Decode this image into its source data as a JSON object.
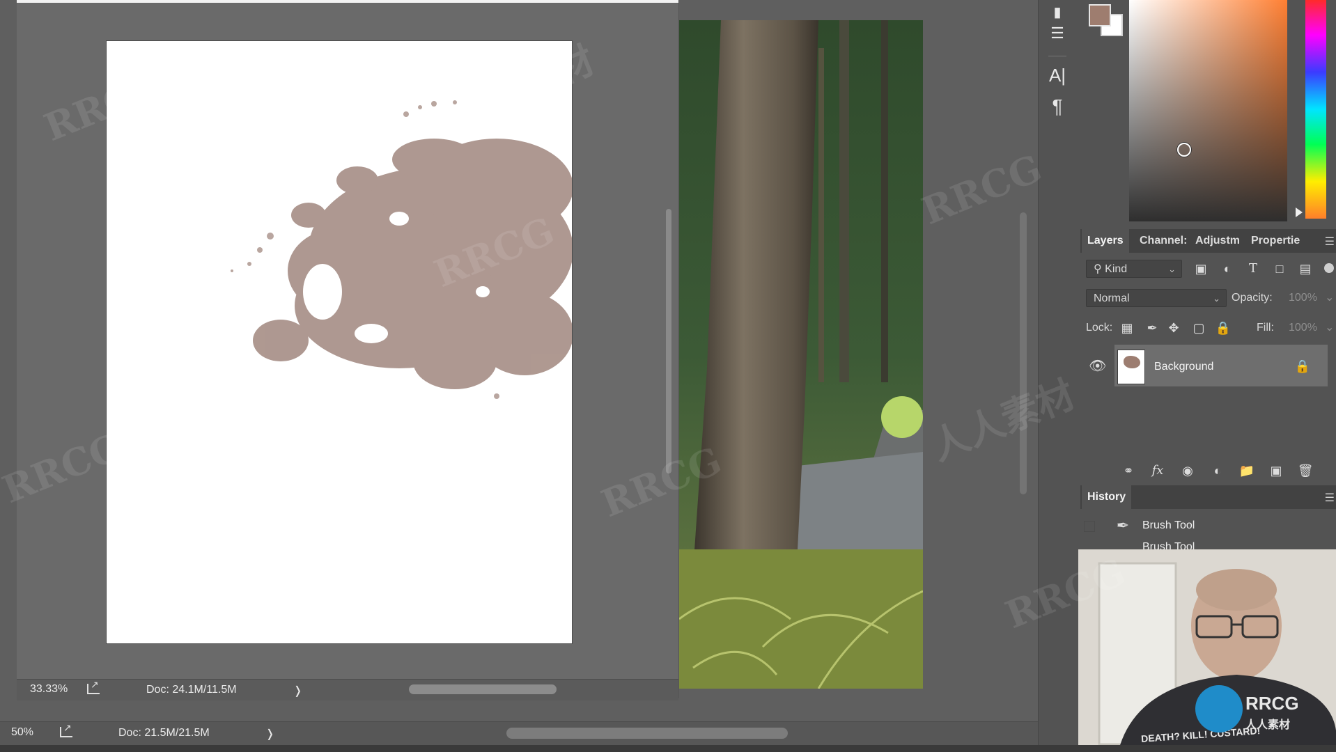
{
  "doc_window_left": {
    "zoom": "33.33%",
    "doc_size": "Doc: 24.1M/11.5M",
    "arrow": "❭"
  },
  "main_status": {
    "zoom": "50%",
    "doc_size": "Doc: 21.5M/21.5M",
    "arrow": "❭"
  },
  "tools": {
    "type_tool": "A|",
    "paragraph_tool": "¶"
  },
  "colors": {
    "foreground": "#9e7d6f",
    "background": "#ffffff"
  },
  "layers_panel": {
    "tabs": [
      "Layers",
      "Channel:",
      "Adjustm",
      "Propertie"
    ],
    "filter_kind": "Kind",
    "blend_mode": "Normal",
    "opacity_label": "Opacity:",
    "opacity_value": "100%",
    "lock_label": "Lock:",
    "fill_label": "Fill:",
    "fill_value": "100%",
    "layers": [
      {
        "name": "Background",
        "visible": true,
        "locked": true
      }
    ]
  },
  "history_panel": {
    "title": "History",
    "items": [
      "Brush Tool",
      "Brush Tool"
    ]
  },
  "webcam": {
    "shirt_text": "DEATH? KILL! CUSTARD!",
    "logo_text": "RRCG",
    "logo_subtext": "人人素材"
  },
  "watermarks": [
    "RRCG",
    "人人素材"
  ]
}
